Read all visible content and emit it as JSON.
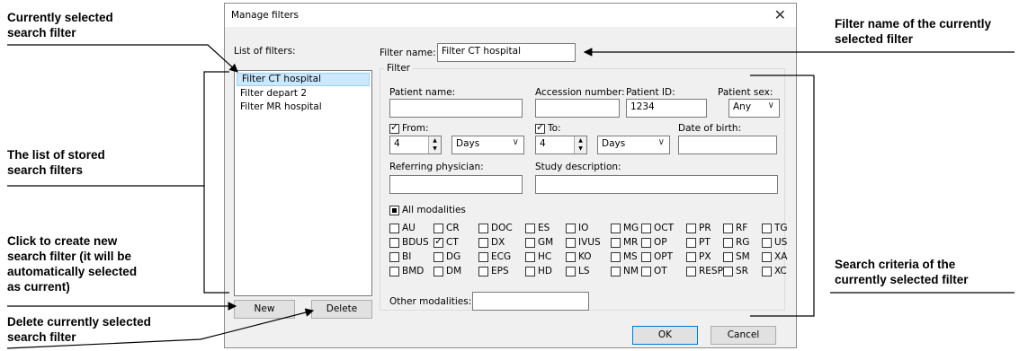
{
  "annotations": {
    "selected_filter": [
      "Currently selected",
      "search filter"
    ],
    "stored_filters": [
      "The list of stored",
      "search filters"
    ],
    "create_new": [
      "Click to create new",
      "search filter (it will be",
      "automatically selected",
      "as current)"
    ],
    "delete_filter": [
      "Delete currently selected",
      "search filter"
    ],
    "filter_name": [
      "Filter name of the currently",
      "selected filter"
    ],
    "search_criteria": [
      "Search criteria of the",
      "currently selected filter"
    ]
  },
  "dialog": {
    "title": "Manage filters",
    "close_glyph": "✕",
    "list_label": "List of filters:",
    "filters": [
      "Filter CT hospital",
      "Filter depart 2",
      "Filter MR hospital"
    ],
    "selected_index": 0,
    "new_label": "New",
    "delete_label": "Delete",
    "filter_name_label": "Filter name:",
    "filter_name_value": "Filter CT hospital",
    "group_label": "Filter",
    "patient_name_label": "Patient name:",
    "patient_name_value": "",
    "accession_label": "Accession number:",
    "accession_value": "",
    "patient_id_label": "Patient ID:",
    "patient_id_value": "1234",
    "patient_sex_label": "Patient sex:",
    "patient_sex_value": "Any",
    "from_label": "From:",
    "from_checked": true,
    "from_value": "4",
    "from_unit": "Days",
    "to_label": "To:",
    "to_checked": true,
    "to_value": "4",
    "to_unit": "Days",
    "dob_label": "Date of birth:",
    "dob_value": "",
    "referring_label": "Referring physician:",
    "referring_value": "",
    "study_desc_label": "Study description:",
    "study_desc_value": "",
    "all_modalities_label": "All modalities",
    "modalities": [
      [
        "AU",
        "CR",
        "DOC",
        "ES",
        "IO",
        "MG",
        "OCT",
        "PR",
        "RF",
        "TG"
      ],
      [
        "BDUS",
        "CT",
        "DX",
        "GM",
        "IVUS",
        "MR",
        "OP",
        "PT",
        "RG",
        "US"
      ],
      [
        "BI",
        "DG",
        "ECG",
        "HC",
        "KO",
        "MS",
        "OPT",
        "PX",
        "SM",
        "XA"
      ],
      [
        "BMD",
        "DM",
        "EPS",
        "HD",
        "LS",
        "NM",
        "OT",
        "RESP",
        "SR",
        "XC"
      ]
    ],
    "checked_modalities": [
      "CT"
    ],
    "other_modalities_label": "Other modalities:",
    "other_modalities_value": "",
    "ok_label": "OK",
    "cancel_label": "Cancel"
  }
}
